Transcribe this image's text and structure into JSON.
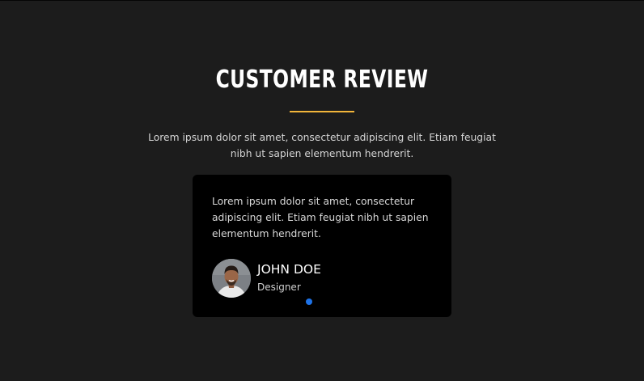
{
  "section": {
    "title": "CUSTOMER REVIEW",
    "intro": "Lorem ipsum dolor sit amet, consectetur adipiscing elit. Etiam feugiat nibh ut sapien elementum hendrerit."
  },
  "review": {
    "quote": "Lorem ipsum dolor sit amet, consectetur adipiscing elit. Etiam feugiat nibh ut sapien elementum hendrerit.",
    "name": "JOHN DOE",
    "role": "Designer",
    "avatar_icon": "person-photo-icon"
  },
  "carousel": {
    "active_index": 1,
    "total": 1
  },
  "colors": {
    "background": "#1c1c1c",
    "card": "#000000",
    "accent": "#f2b53a",
    "dot_active": "#1e73e8"
  }
}
